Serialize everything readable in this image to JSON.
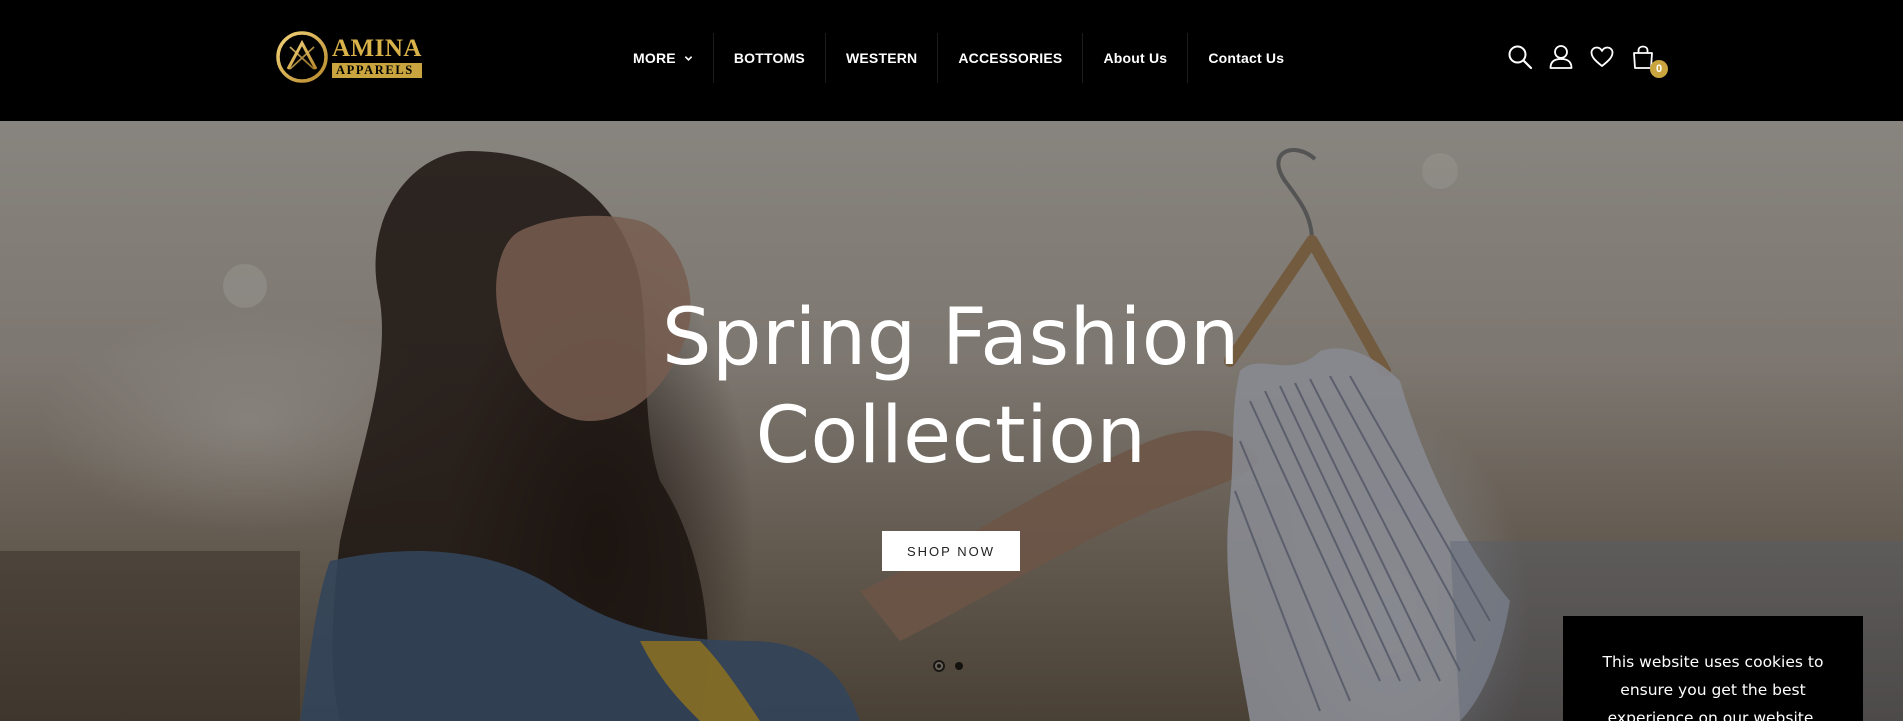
{
  "brand": {
    "name": "AMINA",
    "subtitle": "APPARELS",
    "accent_color": "#c9a43f"
  },
  "nav": {
    "items": [
      {
        "label": "MORE",
        "has_dropdown": true
      },
      {
        "label": "BOTTOMS"
      },
      {
        "label": "WESTERN"
      },
      {
        "label": "ACCESSORIES"
      },
      {
        "label": "About Us"
      },
      {
        "label": "Contact Us"
      }
    ]
  },
  "header_icons": {
    "search": "search-icon",
    "account": "user-icon",
    "wishlist": "heart-icon",
    "cart": "shopping-bag-icon",
    "cart_count": "0"
  },
  "hero": {
    "title_line1": "Spring Fashion",
    "title_line2": "Collection",
    "cta_label": "SHOP NOW",
    "slides_total": 2,
    "active_slide": 1
  },
  "cookie": {
    "text": "This website uses cookies to ensure you get the best experience on our website."
  }
}
